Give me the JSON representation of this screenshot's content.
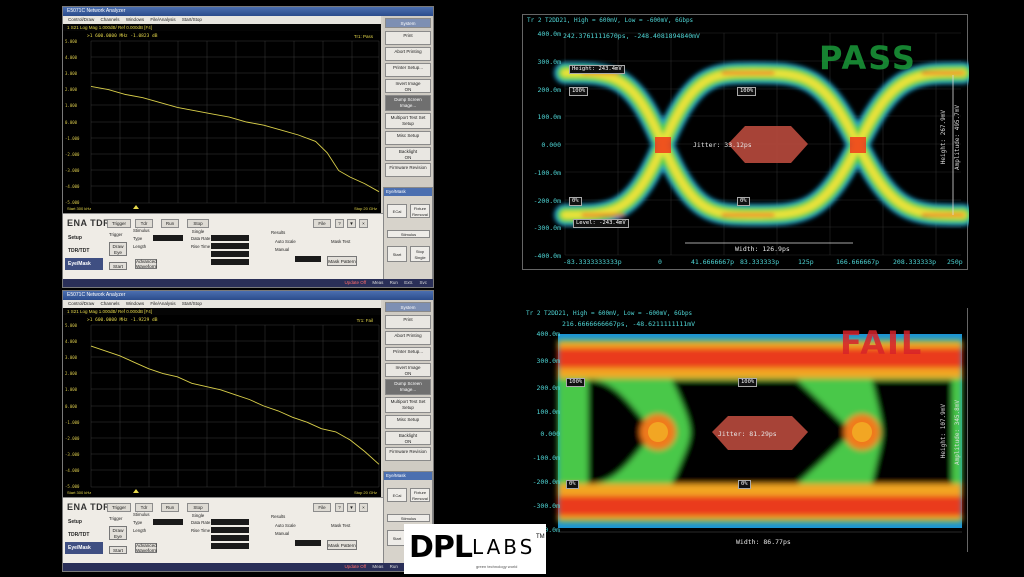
{
  "analyzer": {
    "title": "E5071C Network Analyzer",
    "menu": [
      "Control/Draw",
      "Channels",
      "Windows",
      "File/Analysis",
      "Start/Stop"
    ],
    "system_label": "System",
    "side_buttons": [
      "Print",
      "Abort Printing",
      "Printer Setup...",
      "Invert Image",
      "Dump Screen Image...",
      "Multiport Test Set Setup",
      "Misc Setup",
      "Backlight",
      "Firmware Revision"
    ],
    "backlight_state": "ON",
    "invert_state": "ON",
    "product": "ENA TDR",
    "tabs": [
      "Trigger",
      "Tdr",
      "Run",
      "Stop Single"
    ],
    "file_label": "File",
    "side_items": [
      "Setup",
      "TDR/TDT",
      "Eye/Mask"
    ],
    "stimulus_label": "Stimulus",
    "trigger_label": "Trigger",
    "fields": [
      "Type",
      "Length",
      "Data Rate",
      "Rise Time"
    ],
    "draw_eye": "Draw Eye",
    "start": "Start",
    "advanced_waveform": "Advanced Waveform",
    "results": "Results",
    "mask_test": "Mask Test",
    "auto_scale": "Auto Scale",
    "manual": "Manual",
    "mask_pattern": "Mask Pattern",
    "eye_panel_title": "Eye/Mask",
    "eye_panel_items": [
      "Calibration",
      "ECal",
      "Fixture Removal",
      "Stimulus",
      "Start",
      "Stop Single"
    ],
    "status": "Update Off",
    "status_items": [
      "Meas",
      "Run",
      "Extr.",
      "Svc"
    ]
  },
  "top_analyzer": {
    "trace_header": "1 S21 Log Mag 1.000dB/ Ref 0.000dB [F4]",
    "marker": ">1  600.0000 MHz  -1.0823 dB",
    "mode": "Tr1: Pass",
    "yticks": [
      "5.000",
      "4.000",
      "3.000",
      "2.000",
      "1.000",
      "0.000",
      "-1.000",
      "-2.000",
      "-3.000",
      "-4.000",
      "-5.000"
    ],
    "start": "Start 300 kHz",
    "stop": "Stop 20 GHz",
    "curve": [
      [
        0.0,
        0.28
      ],
      [
        0.06,
        0.3
      ],
      [
        0.12,
        0.33
      ],
      [
        0.18,
        0.35
      ],
      [
        0.24,
        0.38
      ],
      [
        0.3,
        0.41
      ],
      [
        0.36,
        0.43
      ],
      [
        0.42,
        0.45
      ],
      [
        0.48,
        0.47
      ],
      [
        0.54,
        0.5
      ],
      [
        0.6,
        0.52
      ],
      [
        0.66,
        0.55
      ],
      [
        0.72,
        0.58
      ],
      [
        0.78,
        0.62
      ],
      [
        0.82,
        0.69
      ],
      [
        0.86,
        0.8
      ],
      [
        0.9,
        0.84
      ],
      [
        0.95,
        0.88
      ],
      [
        1.0,
        0.93
      ]
    ]
  },
  "bottom_analyzer": {
    "trace_header": "1 S21 Log Mag 1.000dB/ Ref 0.000dB [F4]",
    "marker": ">1  600.0000 MHz  -1.9229 dB",
    "mode": "Tr1: Fail",
    "yticks": [
      "5.000",
      "4.000",
      "3.000",
      "2.000",
      "1.000",
      "0.000",
      "-1.000",
      "-2.000",
      "-3.000",
      "-4.000",
      "-5.000"
    ],
    "start": "Start 300 kHz",
    "stop": "Stop 20 GHz",
    "curve": [
      [
        0.0,
        0.13
      ],
      [
        0.05,
        0.16
      ],
      [
        0.1,
        0.19
      ],
      [
        0.15,
        0.23
      ],
      [
        0.2,
        0.27
      ],
      [
        0.25,
        0.3
      ],
      [
        0.3,
        0.32
      ],
      [
        0.35,
        0.36
      ],
      [
        0.4,
        0.38
      ],
      [
        0.45,
        0.4
      ],
      [
        0.5,
        0.43
      ],
      [
        0.55,
        0.46
      ],
      [
        0.6,
        0.5
      ],
      [
        0.65,
        0.53
      ],
      [
        0.7,
        0.57
      ],
      [
        0.75,
        0.6
      ],
      [
        0.8,
        0.64
      ],
      [
        0.85,
        0.66
      ],
      [
        0.9,
        0.71
      ],
      [
        0.95,
        0.78
      ],
      [
        1.0,
        0.86
      ]
    ]
  },
  "pass_eye": {
    "header": "Tr 2 T2DD21, High = 600mV, Low = -600mV, 6Gbps",
    "cursor": "242.3761111670ps,  -248.4081894840mV",
    "verdict": "PASS",
    "verdict_color": "#1b9b3a",
    "yticks": [
      "400.0m",
      "300.0m",
      "200.0m",
      "100.0m",
      "0.000",
      "-100.0m",
      "-200.0m",
      "-300.0m",
      "-400.0m"
    ],
    "xticks": [
      "-83.3333333333p",
      "0",
      "41.6666667p",
      "83.333333p",
      "125p",
      "166.666667p",
      "208.333333p",
      "250p"
    ],
    "tags": [
      "Height: 243.4mV",
      "100%",
      "100%",
      "0%",
      "0%",
      "Level: -243.4mV"
    ],
    "jitter": "Jitter: 33.12ps",
    "width": "Width: 126.9ps",
    "height": "Height: 267.9mV",
    "amplitude": "Amplitude: 495.7mV"
  },
  "fail_eye": {
    "header": "Tr 2 T2DD21, High = 600mV, Low = -600mV, 6Gbps",
    "cursor": "216.6666666667ps,  -48.6211111111mV",
    "verdict": "FAIL",
    "verdict_color": "#d8232a",
    "yticks": [
      "400.0m",
      "300.0m",
      "200.0m",
      "100.0m",
      "0.000",
      "-100.0m",
      "-200.0m",
      "-300.0m",
      "-400.0m"
    ],
    "tags": [
      "100%",
      "100%",
      "0%",
      "0%"
    ],
    "jitter": "Jitter: 81.29ps",
    "width": "Width: 86.77ps",
    "height": "Height: 107.9mV",
    "amplitude": "Amplitude: 345.8mV"
  },
  "logo": {
    "dpl": "DPL",
    "labs": "LABS",
    "tm": "TM",
    "tagline": "green technology world"
  },
  "colors": {
    "background": "#000000",
    "pass": "#1b9b3a",
    "fail": "#d8232a",
    "trace": "#d9cf4a"
  }
}
